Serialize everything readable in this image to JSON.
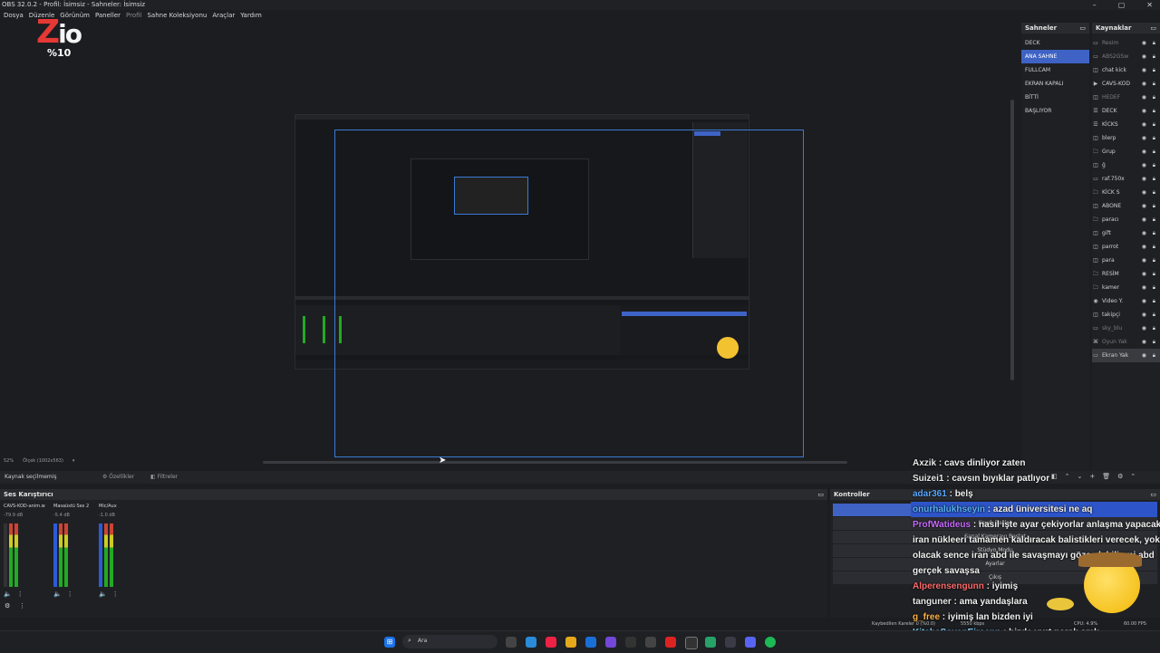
{
  "window": {
    "title": "OBS 32.0.2 - Profil: İsimsiz - Sahneler: İsimsiz"
  },
  "menu": [
    "Dosya",
    "Düzenle",
    "Görünüm",
    "Paneller",
    "Profil",
    "Sahne Koleksiyonu",
    "Araçlar",
    "Yardım"
  ],
  "overlay_logo": {
    "text_main": "ZiO",
    "text_sub": "%10"
  },
  "preview": {
    "zoom": "52%",
    "scale_label": "Ölçek (1002x563)"
  },
  "scenes": {
    "title": "Sahneler",
    "items": [
      "DECK",
      "ANA SAHNE",
      "FULLCAM",
      "EKRAN KAPALI",
      "BİTTİ",
      "BAŞLIYOR"
    ],
    "active_index": 1
  },
  "sources": {
    "title": "Kaynaklar",
    "items": [
      {
        "label": "Resim",
        "icon": "image-icon",
        "dim": true
      },
      {
        "label": "ABS2GSw",
        "icon": "image-icon",
        "dim": true
      },
      {
        "label": "chat kick",
        "icon": "browser-icon",
        "dim": false
      },
      {
        "label": "CAVS-KOD",
        "icon": "media-icon",
        "dim": false
      },
      {
        "label": "HEDEF",
        "icon": "browser-icon",
        "dim": true
      },
      {
        "label": "DECK",
        "icon": "list-icon",
        "dim": false
      },
      {
        "label": "KİCKS",
        "icon": "list-icon",
        "dim": false
      },
      {
        "label": "blerp",
        "icon": "browser-icon",
        "dim": false
      },
      {
        "label": "Grup",
        "icon": "folder-icon",
        "dim": false
      },
      {
        "label": "ğ",
        "icon": "browser-icon",
        "dim": false
      },
      {
        "label": "raf.750x",
        "icon": "image-icon",
        "dim": false
      },
      {
        "label": "KİCK S",
        "icon": "folder-icon",
        "dim": false
      },
      {
        "label": "ABONE",
        "icon": "browser-icon",
        "dim": false
      },
      {
        "label": "paracı",
        "icon": "folder-icon",
        "dim": false
      },
      {
        "label": "gift",
        "icon": "browser-icon",
        "dim": false
      },
      {
        "label": "parrot",
        "icon": "browser-icon",
        "dim": false
      },
      {
        "label": "para",
        "icon": "browser-icon",
        "dim": false
      },
      {
        "label": "RESİM",
        "icon": "folder-icon",
        "dim": false
      },
      {
        "label": "kamer",
        "icon": "folder-icon",
        "dim": false
      },
      {
        "label": "Video Y.",
        "icon": "camera-icon",
        "dim": false
      },
      {
        "label": "takipçi",
        "icon": "browser-icon",
        "dim": false
      },
      {
        "label": "sky_blu",
        "icon": "image-icon",
        "dim": true
      },
      {
        "label": "Oyun Yak",
        "icon": "gamepad-icon",
        "dim": true
      },
      {
        "label": "Ekran Yak",
        "icon": "monitor-icon",
        "dim": false
      }
    ]
  },
  "source_bar": {
    "no_selection": "Kaynak seçilmemiş",
    "properties": "Özellikler",
    "filters": "Filtreler"
  },
  "mixer": {
    "title": "Ses Karıştırıcı",
    "channels": [
      {
        "name": "CAVS-KOD-anim.w",
        "db": "-79.9 dB"
      },
      {
        "name": "Masaüstü Ses 2",
        "db": "-5.4 dB"
      },
      {
        "name": "Mic/Aux",
        "db": "-1.0 dB"
      }
    ]
  },
  "controls": {
    "title": "Kontroller",
    "buttons": [
      "Yayını Başlat",
      "Kaydı Başlat",
      "Sanal Kamerayı Başlat",
      "Stüdyo Modu",
      "Ayarlar",
      "Çıkış"
    ]
  },
  "status": {
    "dropped": "Kaybedilen Kareler 0 (%0.0)",
    "kbps": "5550 kbps",
    "cpu": "CPU: 4.9%",
    "fps": "60.00 FPS"
  },
  "chat": [
    {
      "user": "Axzik",
      "color": "#e8e8e8",
      "msg": "cavs dinliyor zaten"
    },
    {
      "user": "Suizei1",
      "color": "#e8e8e8",
      "msg": "cavsın bıyıklar patlıyor"
    },
    {
      "user": "adar361",
      "color": "#5aa8ff",
      "msg": "belş"
    },
    {
      "user": "onurhalukhseyin",
      "color": "#58b4ff",
      "msg": "azad üniversitesi ne aq",
      "highlight": true
    },
    {
      "user": "ProfWatideus",
      "color": "#c86bff",
      "msg": "nasıl işte ayar çekiyorlar anlaşma yapacaklar"
    },
    {
      "user": "",
      "color": "#e8e8e8",
      "msg": "iran nükleeri tamamen kaldıracak balistikleri verecek, yoksa ne"
    },
    {
      "user": "",
      "color": "#e8e8e8",
      "msg": "olacak sence iran abd ile savaşmayı göze alabilir mi abd"
    },
    {
      "user": "",
      "color": "#e8e8e8",
      "msg": "gerçek savaşsa"
    },
    {
      "user": "Alperensengunn",
      "color": "#ff6b6b",
      "msg": "iyimiş"
    },
    {
      "user": "tanguner",
      "color": "#e8e8e8",
      "msg": "ama yandaşlara"
    },
    {
      "user": "g_free",
      "color": "#ffb347",
      "msg": "iyimiş lan bizden iyi"
    },
    {
      "user": "KitabaSovenEiraenn",
      "color": "#7fd3ff",
      "msg": "bizde yurt paralı amk"
    }
  ],
  "taskbar": {
    "search_placeholder": "Ara"
  }
}
